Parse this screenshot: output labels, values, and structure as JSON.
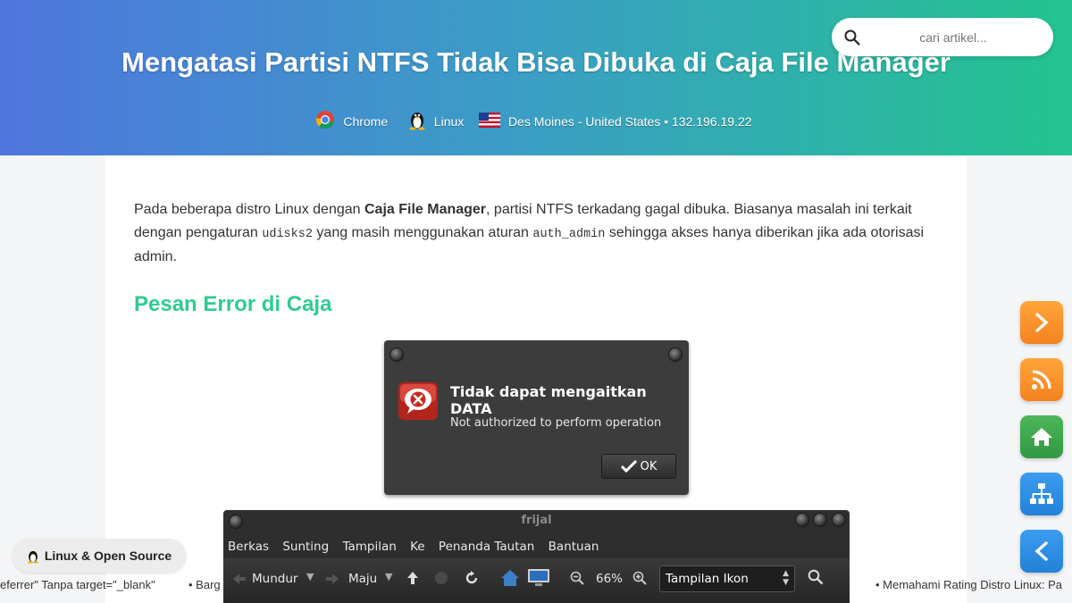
{
  "header": {
    "title": "Mengatasi Partisi NTFS Tidak Bisa Dibuka di Caja File Manager",
    "meta": {
      "browser": "Chrome",
      "os": "Linux",
      "location": "Des Moines - United States • 132.196.19.22"
    },
    "search": {
      "placeholder": "cari artikel..."
    }
  },
  "article": {
    "intro": {
      "p1": "Pada beberapa distro Linux dengan ",
      "bold": "Caja File Manager",
      "p2": ", partisi NTFS terkadang gagal dibuka. Biasanya masalah ini terkait dengan pengaturan ",
      "code1": "udisks2",
      "p3": " yang masih menggunakan aturan ",
      "code2": "auth_admin",
      "p4": " sehingga akses hanya diberikan jika ada otorisasi admin."
    },
    "heading": "Pesan Error di Caja",
    "dialog": {
      "title": "Tidak dapat mengaitkan DATA",
      "message": "Not authorized to perform operation",
      "ok": "OK"
    },
    "file_manager": {
      "title": "frijal",
      "menu": [
        "Berkas",
        "Sunting",
        "Tampilan",
        "Ke",
        "Penanda Tautan",
        "Bantuan"
      ],
      "back": "Mundur",
      "forward": "Maju",
      "zoom": "66%",
      "view": "Tampilan Ikon"
    }
  },
  "sidebar_buttons": {
    "next": "next",
    "rss": "rss",
    "home": "home",
    "sitemap": "sitemap",
    "prev": "prev"
  },
  "badge": "Linux & Open Source",
  "ticker": {
    "item1": "eferrer\" Tanpa target=\"_blank\"",
    "item2": "• Barg",
    "item3": "• Memahami Rating Distro Linux: Pa"
  },
  "colors": {
    "hero_start": "#4f76de",
    "hero_end": "#23c48f",
    "heading": "#2ecc8f",
    "btn_orange": "#f7941d",
    "btn_green": "#3aa54a",
    "btn_blue": "#2d8fe0"
  }
}
